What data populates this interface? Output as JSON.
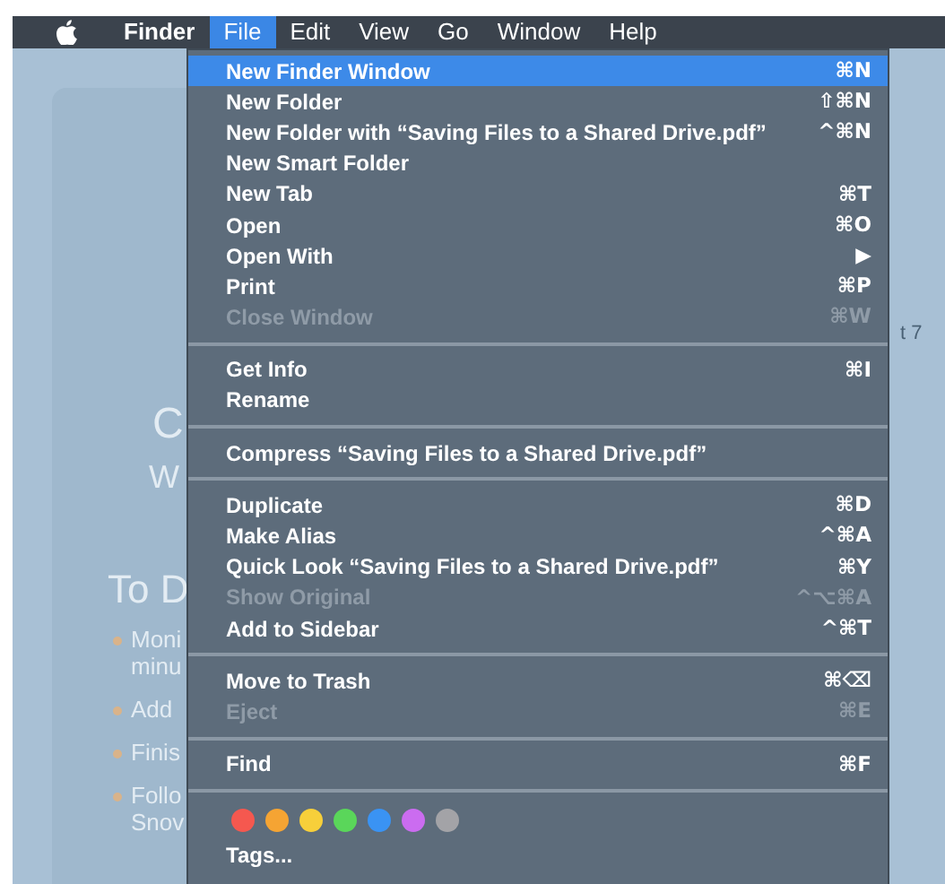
{
  "menu_bar": [
    {
      "label": "Finder",
      "kind": "app",
      "selected": false
    },
    {
      "label": "File",
      "kind": "menu",
      "selected": true
    },
    {
      "label": "Edit",
      "kind": "menu",
      "selected": false
    },
    {
      "label": "View",
      "kind": "menu",
      "selected": false
    },
    {
      "label": "Go",
      "kind": "menu",
      "selected": false
    },
    {
      "label": "Window",
      "kind": "menu",
      "selected": false
    },
    {
      "label": "Help",
      "kind": "menu",
      "selected": false
    }
  ],
  "background_document": {
    "heading_fragments": [
      "C",
      "W"
    ],
    "section_title": "To D",
    "side_fragment": "t 7",
    "bullets": [
      {
        "lines": [
          "Moni",
          "minu"
        ]
      },
      {
        "lines": [
          "Add"
        ]
      },
      {
        "lines": [
          "Finis"
        ]
      },
      {
        "lines": [
          "Follo",
          "Snov"
        ]
      }
    ]
  },
  "menu": [
    {
      "kind": "item",
      "label": "New Finder Window",
      "shortcut": "⌘N",
      "selected": true,
      "disabled": false
    },
    {
      "kind": "item",
      "label": "New Folder",
      "shortcut": "⇧⌘N",
      "selected": false,
      "disabled": false
    },
    {
      "kind": "item",
      "label": "New Folder with “Saving Files to a Shared Drive.pdf”",
      "shortcut": "^⌘N",
      "selected": false,
      "disabled": false
    },
    {
      "kind": "item",
      "label": "New Smart Folder",
      "selected": false,
      "disabled": false
    },
    {
      "kind": "item",
      "label": "New Tab",
      "shortcut": "⌘T",
      "selected": false,
      "disabled": false
    },
    {
      "kind": "item",
      "label": "Open",
      "shortcut": "⌘O",
      "selected": false,
      "disabled": false
    },
    {
      "kind": "item",
      "label": "Open With",
      "shortcut": "▶",
      "selected": false,
      "disabled": false
    },
    {
      "kind": "item",
      "label": "Print",
      "shortcut": "⌘P",
      "selected": false,
      "disabled": false
    },
    {
      "kind": "item",
      "label": "Close Window",
      "shortcut": "⌘W",
      "selected": false,
      "disabled": true
    },
    {
      "kind": "separator"
    },
    {
      "kind": "item",
      "label": "Get Info",
      "shortcut": "⌘I",
      "selected": false,
      "disabled": false
    },
    {
      "kind": "item",
      "label": "Rename",
      "selected": false,
      "disabled": false
    },
    {
      "kind": "separator"
    },
    {
      "kind": "item",
      "label": "Compress “Saving Files to a Shared Drive.pdf”",
      "selected": false,
      "disabled": false
    },
    {
      "kind": "separator"
    },
    {
      "kind": "item",
      "label": "Duplicate",
      "shortcut": "⌘D",
      "selected": false,
      "disabled": false
    },
    {
      "kind": "item",
      "label": "Make Alias",
      "shortcut": "^⌘A",
      "selected": false,
      "disabled": false
    },
    {
      "kind": "item",
      "label": "Quick Look “Saving Files to a Shared Drive.pdf”",
      "shortcut": "⌘Y",
      "selected": false,
      "disabled": false
    },
    {
      "kind": "item",
      "label": "Show Original",
      "shortcut": "^⌥⌘A",
      "selected": false,
      "disabled": true
    },
    {
      "kind": "item",
      "label": "Add to Sidebar",
      "shortcut": "^⌘T",
      "selected": false,
      "disabled": false
    },
    {
      "kind": "separator"
    },
    {
      "kind": "item",
      "label": "Move to Trash",
      "shortcut": "⌘⌫",
      "selected": false,
      "disabled": false
    },
    {
      "kind": "item",
      "label": "Eject",
      "shortcut": "⌘E",
      "selected": false,
      "disabled": true
    },
    {
      "kind": "separator"
    },
    {
      "kind": "item",
      "label": "Find",
      "shortcut": "⌘F",
      "selected": false,
      "disabled": false
    },
    {
      "kind": "separator"
    },
    {
      "kind": "tags",
      "tags": [
        {
          "color": "#f5584f"
        },
        {
          "color": "#f5a433"
        },
        {
          "color": "#f7cf3a"
        },
        {
          "color": "#5ad65a"
        },
        {
          "color": "#3a93f3"
        },
        {
          "color": "#cb6cf0"
        },
        {
          "color": "#a3a3a7"
        }
      ]
    },
    {
      "kind": "item",
      "label": "Tags...",
      "selected": false,
      "disabled": false
    }
  ]
}
